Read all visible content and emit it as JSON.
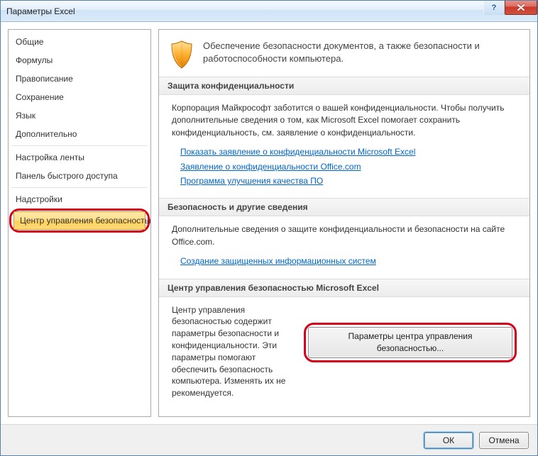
{
  "window": {
    "title": "Параметры Excel"
  },
  "sidebar": {
    "items": [
      {
        "label": "Общие"
      },
      {
        "label": "Формулы"
      },
      {
        "label": "Правописание"
      },
      {
        "label": "Сохранение"
      },
      {
        "label": "Язык"
      },
      {
        "label": "Дополнительно"
      },
      {
        "label": "Настройка ленты"
      },
      {
        "label": "Панель быстрого доступа"
      },
      {
        "label": "Надстройки"
      },
      {
        "label": "Центр управления безопасностью",
        "selected": true,
        "highlighted": true
      }
    ]
  },
  "main": {
    "hero_text": "Обеспечение безопасности документов, а также безопасности и работоспособности компьютера.",
    "sections": {
      "privacy": {
        "title": "Защита конфиденциальности",
        "text": "Корпорация Майкрософт заботится о вашей конфиденциальности. Чтобы получить дополнительные сведения о том, как Microsoft Excel помогает сохранить конфиденциальность, см. заявление о конфиденциальности.",
        "links": [
          "Показать заявление о конфиденциальности Microsoft Excel",
          "Заявление о конфиденциальности Office.com",
          "Программа улучшения качества ПО"
        ]
      },
      "security": {
        "title": "Безопасность и другие сведения",
        "text": "Дополнительные сведения о защите конфиденциальности и безопасности на сайте Office.com.",
        "links": [
          "Создание защищенных информационных систем"
        ]
      },
      "trust": {
        "title": "Центр управления безопасностью Microsoft Excel",
        "text": "Центр управления безопасностью содержит параметры безопасности и конфиденциальности. Эти параметры помогают обеспечить безопасность компьютера. Изменять их не рекомендуется.",
        "button_label": "Параметры центра управления безопасностью..."
      }
    }
  },
  "footer": {
    "ok_label": "ОК",
    "cancel_label": "Отмена"
  }
}
